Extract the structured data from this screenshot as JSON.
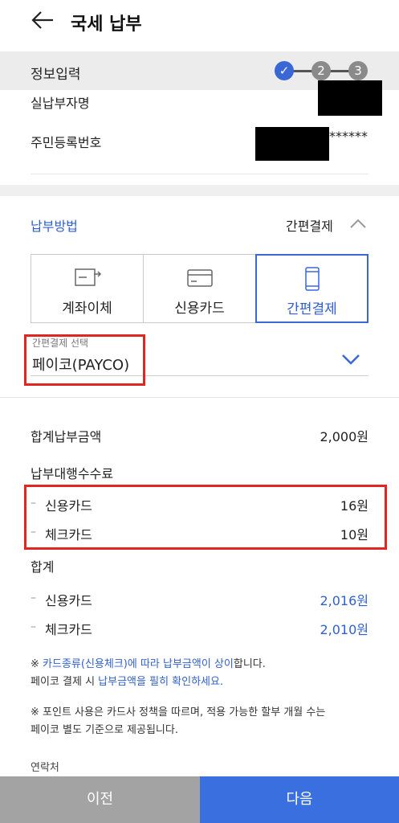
{
  "header": {
    "title": "국세 납부"
  },
  "steps": {
    "label": "정보입력",
    "items": [
      "✓",
      "2",
      "3"
    ]
  },
  "info": {
    "payer_label": "실납부자명",
    "rrn_label": "주민등록번호",
    "rrn_suffix": "******"
  },
  "payment_method": {
    "label": "납부방법",
    "value": "간편결제",
    "tabs": [
      {
        "label": "계좌이체",
        "icon": "account-transfer-icon"
      },
      {
        "label": "신용카드",
        "icon": "credit-card-icon"
      },
      {
        "label": "간편결제",
        "icon": "mobile-pay-icon"
      }
    ],
    "select_label": "간편결제 선택",
    "select_value": "페이코(PAYCO)"
  },
  "amounts": {
    "total_label": "합계납부금액",
    "total_value": "2,000원",
    "fee_label": "납부대행수수료",
    "fee_credit_label": "신용카드",
    "fee_credit_value": "16원",
    "fee_check_label": "체크카드",
    "fee_check_value": "10원",
    "sum_label": "합계",
    "sum_credit_label": "신용카드",
    "sum_credit_value": "2,016원",
    "sum_check_label": "체크카드",
    "sum_check_value": "2,010원"
  },
  "notes": {
    "n1_a": "※ ",
    "n1_b": "카드종류(신용체크)에 따라 납부금액이 상이",
    "n1_c": "합니다.",
    "n2_a": "페이코 결제 시 ",
    "n2_b": "납부금액을 필히 확인하세요.",
    "n3": "※ 포인트 사용은 카드사 정책을 따르며, 적용 가능한 할부 개월 수는",
    "n4": "페이코 별도 기준으로 제공됩니다.",
    "contact": "연락처"
  },
  "footer": {
    "prev": "이전",
    "next": "다음"
  },
  "colors": {
    "accent": "#3a6fe0",
    "highlight": "#e0261f",
    "step_active": "#3a67d6",
    "step_inactive": "#8a8a8a"
  }
}
